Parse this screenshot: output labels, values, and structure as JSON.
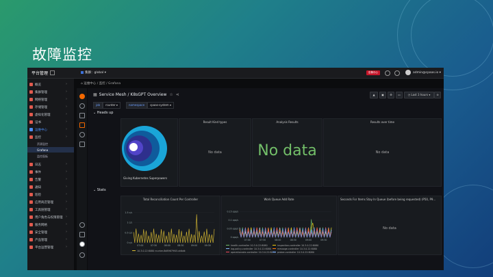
{
  "slide": {
    "title": "故障监控"
  },
  "topbar": {
    "brand": "平台管理",
    "cluster_prefix": "集群：",
    "cluster_value": "global",
    "alert_badge": "告警中心",
    "user": "admin@cpaas.io"
  },
  "sidebar": {
    "items": [
      {
        "label": "概览"
      },
      {
        "label": "集群管理"
      },
      {
        "label": "网络管理"
      },
      {
        "label": "存储管理"
      },
      {
        "label": "虚拟化管理"
      },
      {
        "label": "证书"
      },
      {
        "label": "运维中心",
        "active": true
      },
      {
        "label": "监控"
      }
    ],
    "sub": [
      "资源监控",
      "Grafana",
      "监控面板"
    ],
    "items2": [
      {
        "label": "日志"
      },
      {
        "label": "事件"
      },
      {
        "label": "告警"
      },
      {
        "label": "通知"
      },
      {
        "label": "巡检"
      },
      {
        "label": "应用商店管理"
      },
      {
        "label": "工具链管理"
      },
      {
        "label": "用户角色与权限管理"
      },
      {
        "label": "服务网格"
      },
      {
        "label": "安全管理"
      },
      {
        "label": "产品管理"
      },
      {
        "label": "平台运营管理"
      }
    ]
  },
  "breadcrumb": "运维中心 / 监控 / Grafana",
  "dashboard": {
    "title": "Service Mesh / K8sGPT Overview",
    "time_range": "Last 3 hours",
    "variables": [
      {
        "key": "job",
        "value": "rcunter"
      },
      {
        "key": "namespace",
        "value": "cpaas-system"
      }
    ],
    "row1": "Heads up",
    "row2": "Stats",
    "panels": {
      "logo_caption": "Giving Kubernetes Superpowers",
      "result_kind": {
        "title": "Result Kind types",
        "text": "No data"
      },
      "analysis": {
        "title": "Analysis Results",
        "text": "No data"
      },
      "results_over_time": {
        "title": "Results over time",
        "text": "No data"
      },
      "reconcile": {
        "title": "Total Reconciliation Count Per Controller",
        "legend": [
          "10.3.0.22:8080 rcunter-8d89679f45-ddbdk"
        ]
      },
      "workqueue": {
        "title": "Work Queue Add Rate",
        "legend": [
          "health-controller 10.3.0.22:8080",
          "inspection-controller 10.3.0.22:8080",
          "log-policy-controller 10.3.0.22:8080",
          "message-controller 10.3.0.22:8080",
          "operationrate-controller 10.3.0.22:8080",
          "prober-controller 10.3.0.22:8080"
        ]
      },
      "seconds": {
        "title": "Seconds For Items Stay In Queue (before being requested) (P50, P9...",
        "text": "No data"
      }
    }
  },
  "chart_data": [
    {
      "type": "line",
      "title": "Total Reconciliation Count Per Controller",
      "x": [
        "07:00",
        "07:30",
        "08:00",
        "08:30",
        "09:00",
        "09:30"
      ],
      "ytick_labels": [
        "0 c/s",
        "0.5 c/s",
        "1 c/s",
        "1.5 c/s"
      ],
      "ylim": [
        0,
        0.075
      ],
      "series": [
        {
          "name": "10.3.0.22:8080 rcunter-8d89679f45-ddbdk",
          "color": "#e0c133",
          "pattern": "periodic spikes",
          "typical_peak": 0.03,
          "max_peak": 0.06
        }
      ]
    },
    {
      "type": "line",
      "title": "Work Queue Add Rate",
      "x": [
        "07:00",
        "07:30",
        "08:00",
        "08:30",
        "09:00",
        "09:30"
      ],
      "ytick_labels": [
        "0 ops/s",
        "0.05 ops/s",
        "0.1 ops/s",
        "0.15 ops/s"
      ],
      "ylim": [
        0,
        0.15
      ],
      "series": [
        {
          "name": "health-controller 10.3.0.22:8080",
          "color": "#73bf69"
        },
        {
          "name": "inspection-controller 10.3.0.22:8080",
          "color": "#f2cc0c"
        },
        {
          "name": "log-policy-controller 10.3.0.22:8080",
          "color": "#8ab8ff"
        },
        {
          "name": "message-controller 10.3.0.22:8080",
          "color": "#ff780a"
        },
        {
          "name": "operationrate-controller 10.3.0.22:8080",
          "color": "#f2495c"
        },
        {
          "name": "prober-controller 10.3.0.22:8080",
          "color": "#5794f2"
        }
      ],
      "typical_peak": 0.05,
      "max_peak": 0.09
    }
  ],
  "colors": {
    "accent": "#4c8df6",
    "nodata_big": "#73bf69",
    "grafana": "#f46800"
  }
}
